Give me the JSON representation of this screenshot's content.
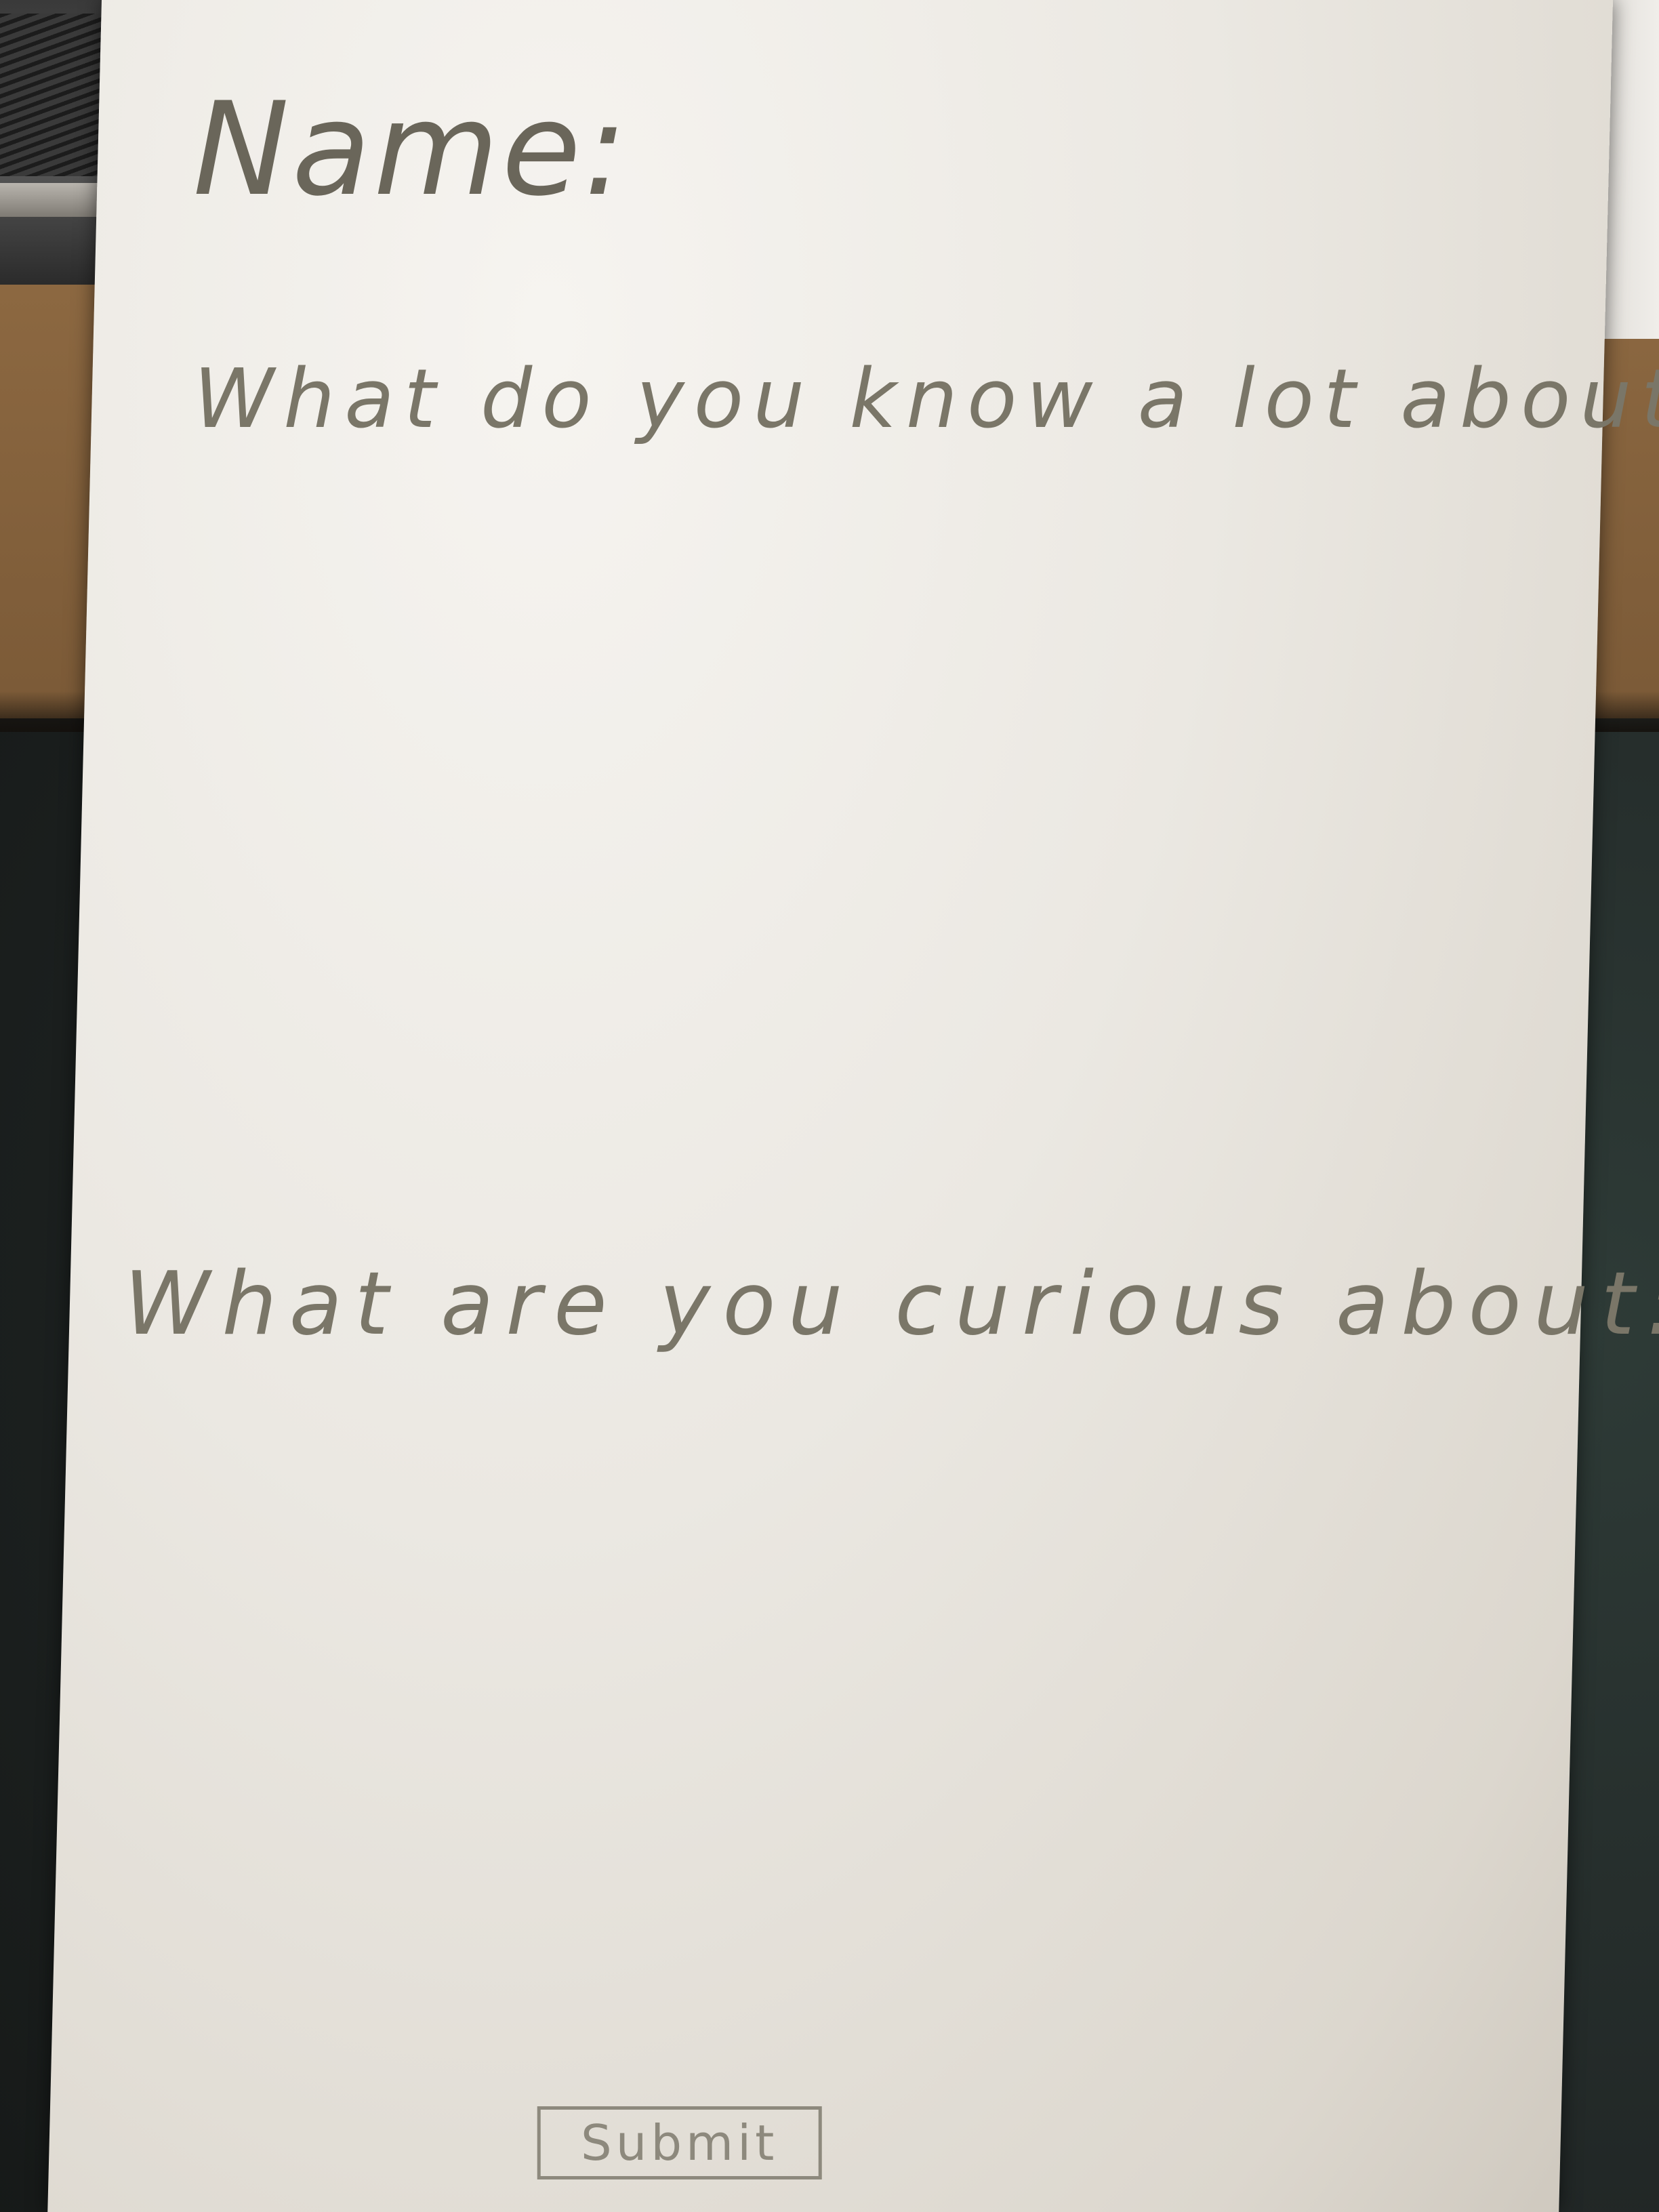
{
  "form": {
    "name_label": "Name:",
    "known_question": "What do you know a lot about:",
    "curious_question": "What are you curious about:",
    "submit_label": "Submit"
  },
  "colors": {
    "paper": "#ebe8e2",
    "ink": "#7a7668",
    "background_cork": "#8c6841",
    "background_table": "#222827"
  }
}
